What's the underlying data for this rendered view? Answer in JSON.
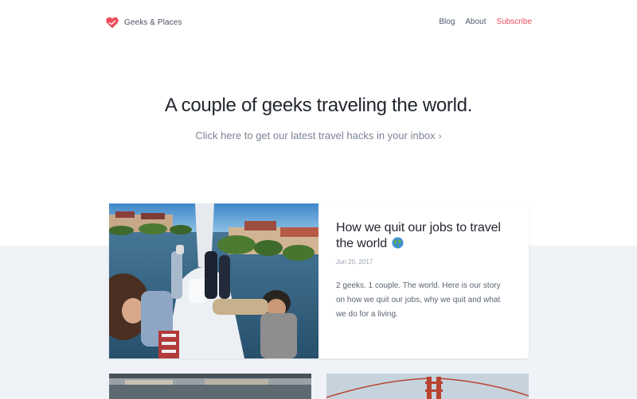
{
  "header": {
    "brand": "Geeks & Places",
    "nav": [
      {
        "label": "Blog"
      },
      {
        "label": "About"
      },
      {
        "label": "Subscribe"
      }
    ]
  },
  "hero": {
    "title": "A couple of geeks traveling the world.",
    "subscribe_link": "Click here to get our latest travel hacks in your inbox",
    "chevron": "›"
  },
  "featured_post": {
    "title": "How we quit our jobs to travel the world",
    "date": "Jun 20, 2017",
    "excerpt": "2 geeks. 1 couple. The world. Here is our story on how we quit our jobs, why we quit and what we do for a living."
  },
  "colors": {
    "accent": "#ef4d5b",
    "nav_text": "#4e5a6e",
    "band": "#eff2f6"
  }
}
